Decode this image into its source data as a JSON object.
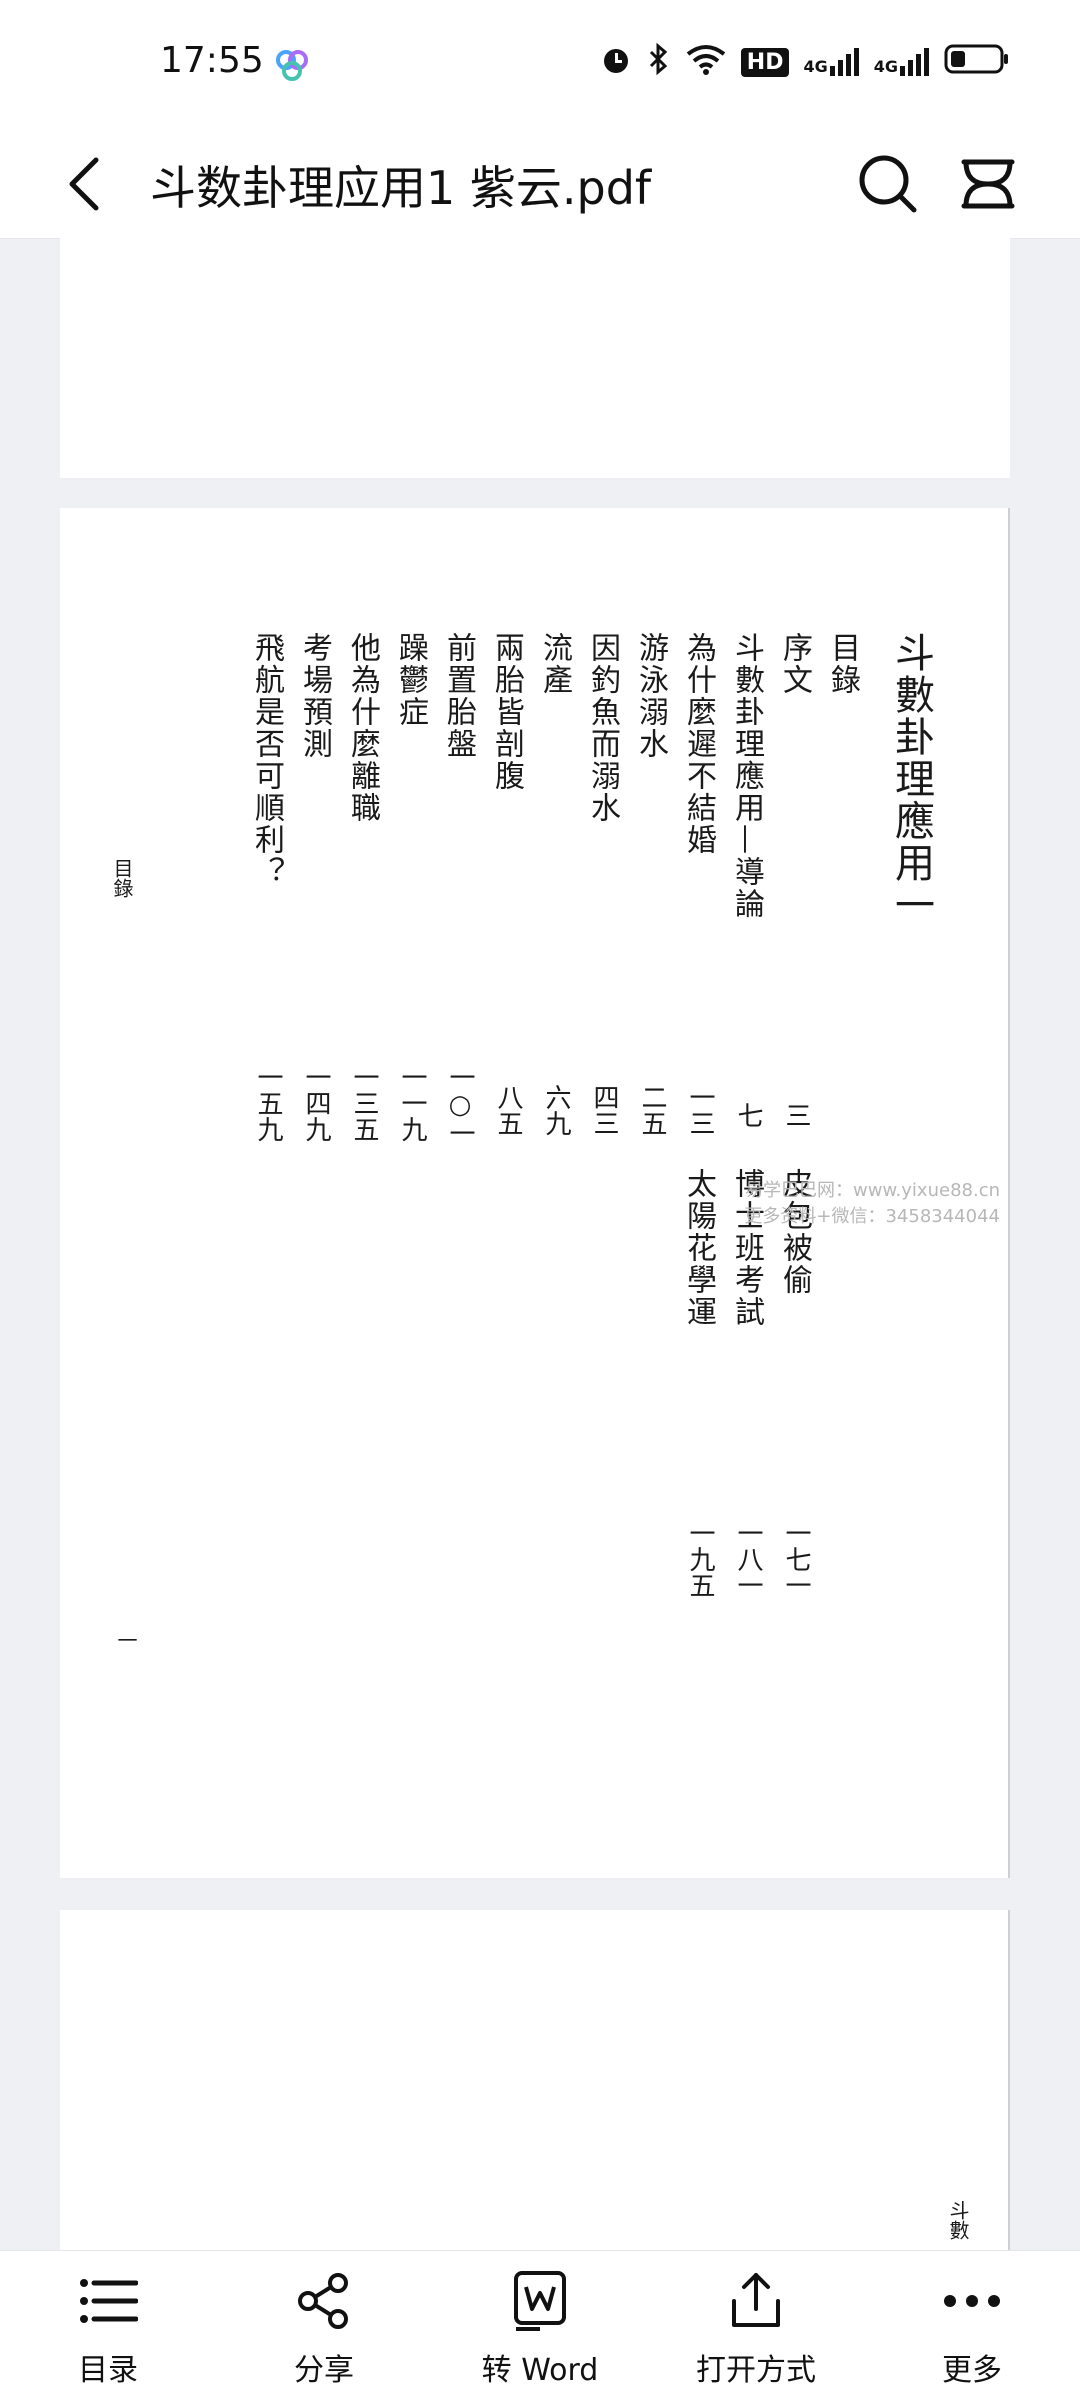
{
  "status_bar": {
    "time": "17:55",
    "hd_label": "HD",
    "network_1": "4G",
    "network_2": "4G"
  },
  "header": {
    "title": "斗数卦理应用1  紫云.pdf"
  },
  "document": {
    "page2": {
      "book_title": "斗數卦理應用一",
      "side_label": "目錄",
      "entries": [
        {
          "title": "目錄",
          "page": ""
        },
        {
          "title": "序文",
          "page": "三"
        },
        {
          "title": "斗數卦理應用—導論",
          "page": "七"
        },
        {
          "title": "為什麼遲不結婚",
          "page": "一三"
        },
        {
          "title": "游泳溺水",
          "page": "二五"
        },
        {
          "title": "因釣魚而溺水",
          "page": "四三"
        },
        {
          "title": "流產",
          "page": "六九"
        },
        {
          "title": "兩胎皆剖腹",
          "page": "八五"
        },
        {
          "title": "前置胎盤",
          "page": "一○一"
        },
        {
          "title": "躁鬱症",
          "page": "一一九"
        },
        {
          "title": "他為什麼離職",
          "page": "一三五"
        },
        {
          "title": "考場預測",
          "page": "一四九"
        },
        {
          "title": "飛航是否可順利？",
          "page": "一五九"
        }
      ],
      "second_column": [
        {
          "title": "皮包被偷",
          "page": "一七一"
        },
        {
          "title": "博士班考試",
          "page": "一八一"
        },
        {
          "title": "太陽花學運",
          "page": "一九五"
        }
      ],
      "page_mark": "一",
      "watermark_line1": "易学巴巴网：www.yixue88.cn",
      "watermark_line2": "更多资料+微信：3458344044"
    },
    "page3": {
      "corner_text": "斗數"
    }
  },
  "bottom_bar": {
    "items": [
      {
        "label": "目录",
        "icon": "list-icon"
      },
      {
        "label": "分享",
        "icon": "share-icon"
      },
      {
        "label": "转 Word",
        "icon": "word-icon"
      },
      {
        "label": "打开方式",
        "icon": "open-with-icon"
      },
      {
        "label": "更多",
        "icon": "more-icon"
      }
    ]
  }
}
